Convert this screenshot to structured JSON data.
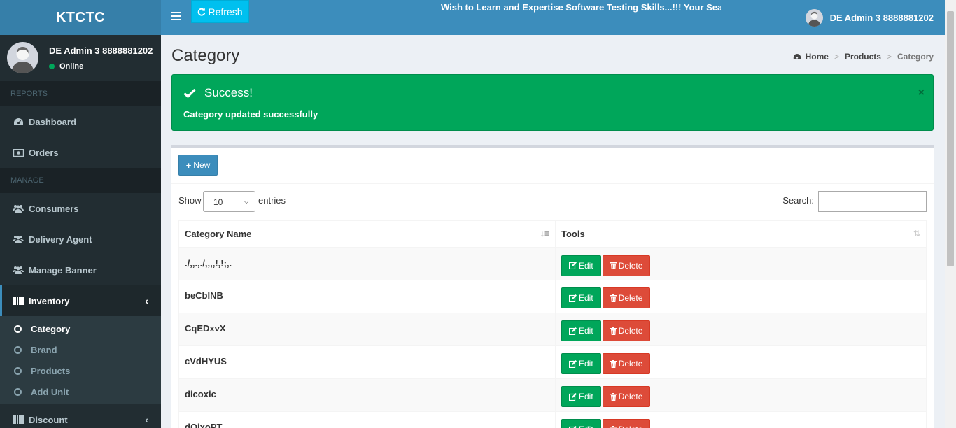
{
  "app": {
    "brand": "KTCTC",
    "refresh_label": "Refresh",
    "marquee": "Wish to Learn and Expertise Software Testing Skills...!!! Your Sear",
    "user_name": "DE Admin 3 8888881202"
  },
  "sidebar": {
    "user_name": "DE Admin 3 8888881202",
    "status": "Online",
    "sections": {
      "reports": "REPORTS",
      "manage": "MANAGE"
    },
    "items": {
      "dashboard": "Dashboard",
      "orders": "Orders",
      "consumers": "Consumers",
      "delivery_agent": "Delivery Agent",
      "manage_banner": "Manage Banner",
      "inventory": "Inventory",
      "discount": "Discount"
    },
    "submenu": {
      "category": "Category",
      "brand": "Brand",
      "products": "Products",
      "add_unit": "Add Unit"
    }
  },
  "page": {
    "title": "Category",
    "breadcrumb": [
      "Home",
      "Products",
      "Category"
    ]
  },
  "alert": {
    "title": "Success!",
    "message": "Category updated successfully",
    "close": "×"
  },
  "table_controls": {
    "new_label": "New",
    "show_label": "Show",
    "entries_value": "10",
    "entries_label": "entries",
    "search_label": "Search:",
    "search_value": ""
  },
  "table": {
    "headers": [
      "Category Name",
      "Tools"
    ],
    "edit_label": "Edit",
    "delete_label": "Delete",
    "rows": [
      "./,,.,./,,,,!,!;,.",
      "beCbINB",
      "CqEDxvX",
      "cVdHYUS",
      "dicoxic",
      "dQjxoPT"
    ]
  },
  "colors": {
    "header": "#3c8dbc",
    "logo": "#367fa9",
    "sidebar": "#222d32",
    "success": "#00a65a",
    "danger": "#dd4b39",
    "refresh": "#00c0ef"
  }
}
